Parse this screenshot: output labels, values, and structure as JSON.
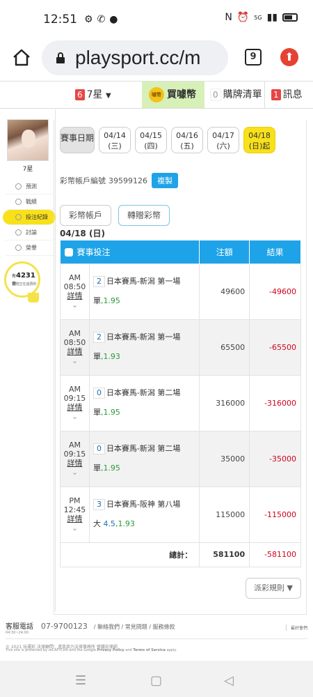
{
  "status_bar": {
    "time": "12:51",
    "network": "5G"
  },
  "browser": {
    "url": "playsport.cc/m",
    "tab_count": "9"
  },
  "site_nav": {
    "star_badge": "6",
    "star_label": "7星",
    "coins_label": "買噱幣",
    "coins_icon_text": "噱幣",
    "cart_badge": "0",
    "cart_label": "購牌清單",
    "msg_badge": "1",
    "msg_label": "訊息"
  },
  "sidebar": {
    "user_name": "7星",
    "items": [
      {
        "label": "預測",
        "icon": "target-icon"
      },
      {
        "label": "戰績",
        "icon": "chat-icon"
      },
      {
        "label": "投注紀錄",
        "icon": "record-icon",
        "active": true
      },
      {
        "label": "討論",
        "icon": "discuss-icon"
      },
      {
        "label": "榮譽",
        "icon": "honor-icon"
      }
    ],
    "bulb_prefix": "有",
    "bulb_count": "4231",
    "bulb_suffix": "億",
    "bulb_text": "點燈正在過預你"
  },
  "date_tabs": {
    "label": "賽事日期",
    "days": [
      {
        "date": "04/14",
        "dow": "(三)"
      },
      {
        "date": "04/15",
        "dow": "(四)"
      },
      {
        "date": "04/16",
        "dow": "(五)"
      },
      {
        "date": "04/17",
        "dow": "(六)"
      },
      {
        "date": "04/18",
        "dow": "(日)起",
        "active": true
      }
    ]
  },
  "account": {
    "label": "彩幣帳戶編號",
    "number": "39599126",
    "copy_label": "複製"
  },
  "coin_tabs": {
    "account_tab": "彩幣帳戶",
    "transfer_tab": "轉贈彩幣"
  },
  "date_heading": "04/18 (日)",
  "table": {
    "headers": {
      "event": "賽事投注",
      "amount": "注額",
      "result": "結果"
    },
    "detail_label": "詳情",
    "rows": [
      {
        "ampm": "AM",
        "time": "08:50",
        "num": "2",
        "event": "日本賽馬-新潟 第一場",
        "pick": "單",
        "hcp": "",
        "odds": "1.95",
        "amount": "49600",
        "result": "-49600"
      },
      {
        "ampm": "AM",
        "time": "08:50",
        "num": "2",
        "event": "日本賽馬-新潟 第一場",
        "pick": "單",
        "hcp": "",
        "odds": "1.93",
        "amount": "65500",
        "result": "-65500"
      },
      {
        "ampm": "AM",
        "time": "09:15",
        "num": "0",
        "event": "日本賽馬-新潟 第二場",
        "pick": "單",
        "hcp": "",
        "odds": "1.95",
        "amount": "316000",
        "result": "-316000"
      },
      {
        "ampm": "AM",
        "time": "09:15",
        "num": "0",
        "event": "日本賽馬-新潟 第二場",
        "pick": "單",
        "hcp": "",
        "odds": "1.95",
        "amount": "35000",
        "result": "-35000"
      },
      {
        "ampm": "PM",
        "time": "12:45",
        "num": "3",
        "event": "日本賽馬-阪神 第八場",
        "pick": "大",
        "hcp": "4.5",
        "odds": "1.93",
        "amount": "115000",
        "result": "-115000"
      }
    ],
    "total_label": "總計：",
    "total_amount": "581100",
    "total_result": "-581100"
  },
  "rules_button": "派彩規則 ▼",
  "footer": {
    "phone_label": "客服電話",
    "hours": "04:30~24:00",
    "phone": "07-9700123",
    "links": [
      "聯絡我們",
      "常見問題",
      "服務條款"
    ],
    "back_label": "最好會們",
    "copyright": "© 2021 玩運彩 法律顧問：遠英商力法律事務所 張鐵宏律師",
    "recaptcha_pre": "This site is protected by reCAPTCHA and the Google",
    "privacy": "Privacy Policy",
    "and": "and",
    "terms": "Terms of Service",
    "apply": "apply."
  },
  "colors": {
    "accent_blue": "#1ea3e8",
    "highlight_yellow": "#f8e11a",
    "loss_red": "#d0021b",
    "odds_green": "#2a9a3a"
  }
}
